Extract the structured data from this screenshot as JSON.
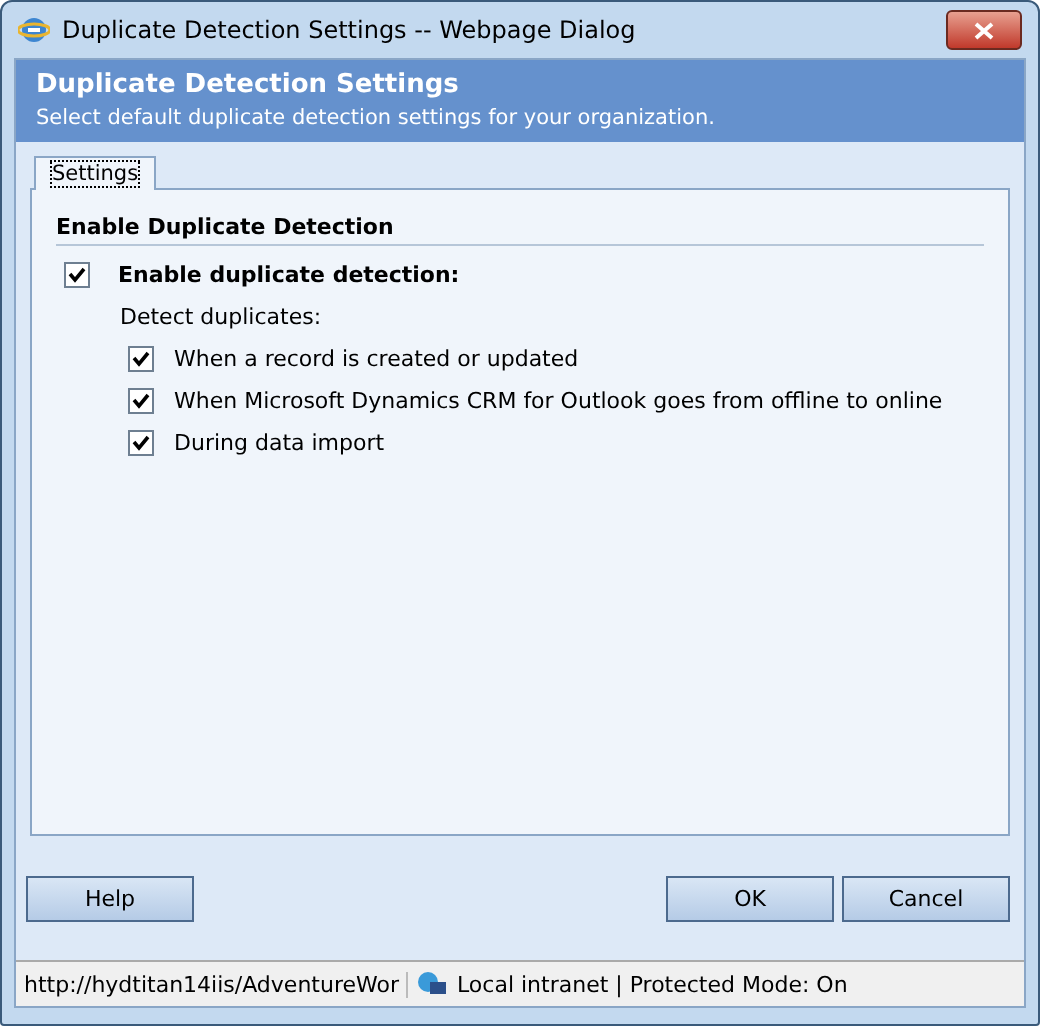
{
  "window": {
    "title": "Duplicate Detection Settings -- Webpage Dialog"
  },
  "header": {
    "title": "Duplicate Detection Settings",
    "subtitle": "Select default duplicate detection settings for your organization."
  },
  "tabs": [
    {
      "label": "Settings",
      "selected": true
    }
  ],
  "section": {
    "title": "Enable Duplicate Detection",
    "master": {
      "label": "Enable duplicate detection:",
      "checked": true
    },
    "sublabel": "Detect duplicates:",
    "options": [
      {
        "label": "When a record is created or updated",
        "checked": true
      },
      {
        "label": "When Microsoft Dynamics CRM for Outlook goes from offline to online",
        "checked": true
      },
      {
        "label": "During data import",
        "checked": true
      }
    ]
  },
  "buttons": {
    "left": [
      "Help"
    ],
    "right": [
      "OK",
      "Cancel"
    ]
  },
  "status_bar": {
    "url": "http://hydtitan14iis/AdventureWor",
    "zone": "Local intranet | Protected Mode: On"
  }
}
